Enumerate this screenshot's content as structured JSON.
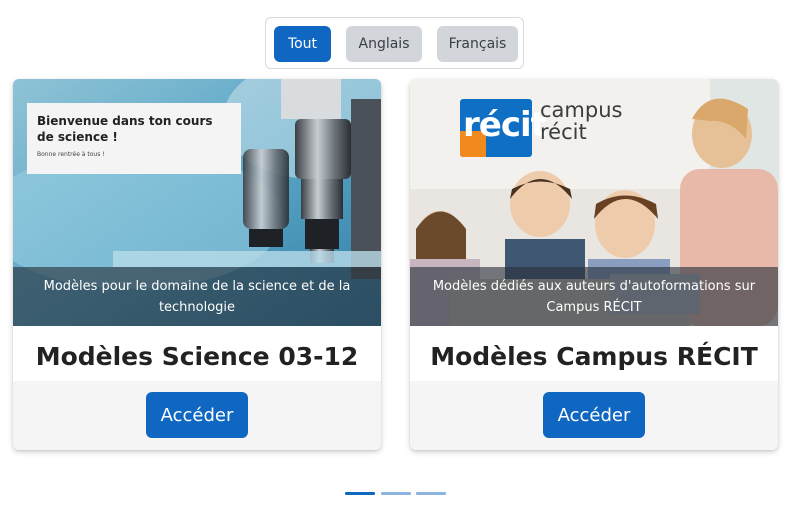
{
  "filters": [
    {
      "label": "Tout",
      "active": true
    },
    {
      "label": "Anglais",
      "active": false
    },
    {
      "label": "Français",
      "active": false
    }
  ],
  "cards": [
    {
      "caption": "Modèles pour le domaine de la science et de la technologie",
      "title": "Modèles Science 03-12",
      "button": "Accéder",
      "image": {
        "welcome_title": "Bienvenue dans ton cours de science !",
        "welcome_sub": "Bonne rentrée à tous !"
      }
    },
    {
      "caption": "Modèles dédiés aux auteurs d'autoformations sur Campus RÉCIT",
      "title": "Modèles Campus RÉCIT",
      "button": "Accéder",
      "image": {
        "logo_text": "récit",
        "logo_campus_line1": "campus",
        "logo_campus_line2": "récit"
      }
    }
  ],
  "carousel": {
    "slides": 3,
    "active_index": 0
  },
  "colors": {
    "accent": "#0f67c2",
    "inactive_filter": "#d2d5da",
    "indicator_inactive": "#8cb4e0"
  }
}
